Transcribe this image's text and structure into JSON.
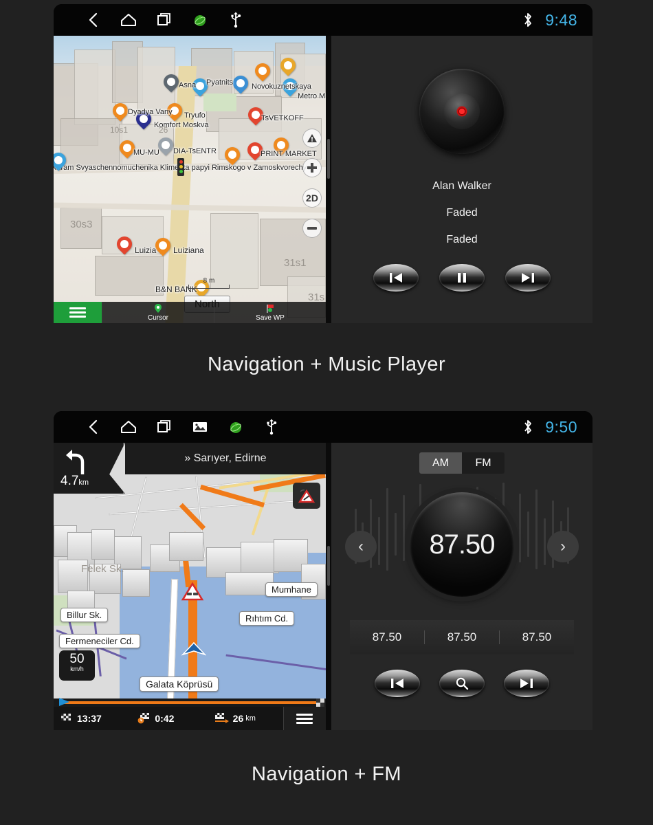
{
  "page": {
    "background": "#212121"
  },
  "captions": {
    "first": "Navigation + Music Player",
    "second": "Navigation + FM"
  },
  "unit1": {
    "statusbar": {
      "icons": [
        "back-icon",
        "home-icon",
        "recents-icon",
        "gps-icon",
        "usb-icon"
      ],
      "bluetooth_icon": "bluetooth-icon",
      "clock": "9:48",
      "clock_color": "#44b5e8"
    },
    "map": {
      "labels": [
        "Asna",
        "Pyatnits",
        "Novokuznetskaya",
        "Metro M",
        "Dyadya Vany",
        "Tryufo",
        "TsVETKOFF",
        "Komfort Moskva",
        "10s1",
        "26",
        "MU-MU",
        "DIA-TsENTR",
        "PRINT MARKET",
        "Khram Svyaschennomuchenika Klimenta papyi Rimskogo v Zamoskvorechye",
        "30s3",
        "Luizia",
        "Luiziana",
        "31s1",
        "31s",
        "B&N BANK"
      ],
      "scale": "8 m",
      "orientation_button": "North",
      "controls": [
        "warning-icon",
        "zoom-in-icon",
        "2D",
        "zoom-out-icon"
      ],
      "bottom": {
        "menu_icon": "hamburger-menu-icon",
        "cursor_label": "Cursor",
        "save_label": "Save WP"
      }
    },
    "player": {
      "artist": "Alan Walker",
      "track": "Faded",
      "album": "Faded",
      "buttons": [
        "previous-track-button",
        "pause-button",
        "next-track-button"
      ]
    }
  },
  "unit2": {
    "statusbar": {
      "icons": [
        "back-icon",
        "home-icon",
        "recents-icon",
        "screenshot-icon",
        "gps-icon",
        "usb-icon"
      ],
      "bluetooth_icon": "bluetooth-icon",
      "clock": "9:50",
      "clock_color": "#44b5e8"
    },
    "map": {
      "turn_distance": "4.7",
      "turn_distance_unit": "km",
      "destination": "» Sarıyer, Edirne",
      "labels": [
        "Felek Sk.",
        "Billur Sk.",
        "Mumhane",
        "Rıhtım Cd.",
        "Fermeneciler Cd.",
        "Galata Köprüsü"
      ],
      "speed_value": "50",
      "speed_unit": "km/h",
      "bottom": {
        "arrival_time": "13:37",
        "remaining_time": "0:42",
        "remaining_distance": "26",
        "remaining_distance_unit": "km",
        "menu_icon": "hamburger-menu-icon"
      }
    },
    "radio": {
      "bands": [
        {
          "label": "AM",
          "active": true
        },
        {
          "label": "FM",
          "active": false
        }
      ],
      "frequency": "87.50",
      "prev_icon": "chevron-left-icon",
      "next_icon": "chevron-right-icon",
      "presets": [
        "87.50",
        "87.50",
        "87.50"
      ],
      "buttons": [
        "seek-down-button",
        "scan-button",
        "seek-up-button"
      ]
    }
  }
}
